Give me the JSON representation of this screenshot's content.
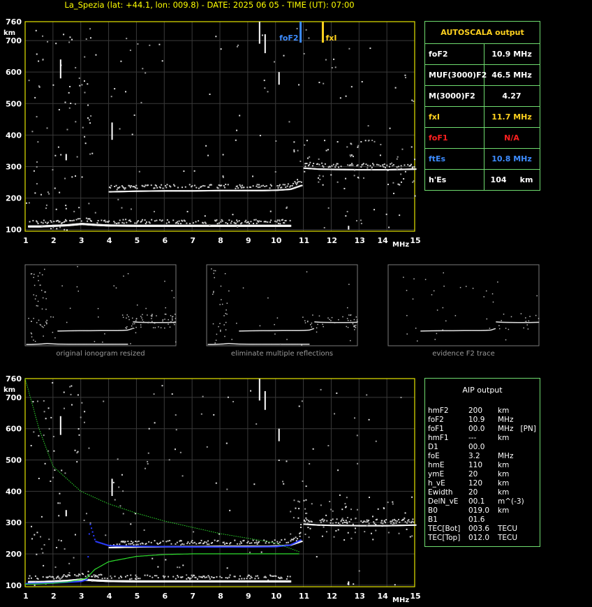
{
  "header": {
    "title": "La_Spezia (lat: +44.1, lon: 009.8) - DATE: 2025 06 05 - TIME (UT): 07:00"
  },
  "ionogram_top": {
    "y_unit": "km",
    "x_unit": "MHz",
    "y_ticks": [
      "760",
      "700",
      "600",
      "500",
      "400",
      "300",
      "200",
      "100"
    ],
    "x_ticks": [
      "1",
      "2",
      "3",
      "4",
      "5",
      "6",
      "7",
      "8",
      "9",
      "10",
      "11",
      "12",
      "13",
      "14",
      "15"
    ],
    "markers": [
      {
        "label": "foF2",
        "freq": 10.9,
        "color": "#3d8cff"
      },
      {
        "label": "fxI",
        "freq": 11.7,
        "color": "#ffd21f"
      }
    ]
  },
  "autoscala": {
    "title": "AUTOSCALA output",
    "rows": [
      {
        "name": "foF2",
        "value": "10.9 MHz",
        "color": "#ffffff"
      },
      {
        "name": "MUF(3000)F2",
        "value": "46.5 MHz",
        "color": "#ffffff"
      },
      {
        "name": "M(3000)F2",
        "value": "4.27",
        "color": "#ffffff"
      },
      {
        "name": "fxI",
        "value": "11.7 MHz",
        "color": "#ffd21f"
      },
      {
        "name": "foF1",
        "value": "N/A",
        "color": "#ff2020"
      },
      {
        "name": "ftEs",
        "value": "10.8 MHz",
        "color": "#3d8cff"
      },
      {
        "name": "h'Es",
        "value": "104     km",
        "color": "#ffffff"
      }
    ]
  },
  "panels": [
    {
      "caption": "original ionogram resized"
    },
    {
      "caption": "eliminate multiple reflections"
    },
    {
      "caption": "evidence F2 trace"
    }
  ],
  "ionogram_bottom": {
    "y_unit": "km",
    "x_unit": "MHz",
    "y_ticks": [
      "760",
      "700",
      "600",
      "500",
      "400",
      "300",
      "200",
      "100"
    ],
    "x_ticks": [
      "1",
      "2",
      "3",
      "4",
      "5",
      "6",
      "7",
      "8",
      "9",
      "10",
      "11",
      "12",
      "13",
      "14",
      "15"
    ]
  },
  "aip": {
    "title": "AIP output",
    "rows": [
      {
        "name": "hmF2",
        "value": "200",
        "unit": "km"
      },
      {
        "name": "foF2",
        "value": "10.9",
        "unit": "MHz"
      },
      {
        "name": "foF1",
        "value": "00.0",
        "unit": "MHz   [PN]"
      },
      {
        "name": "hmF1",
        "value": "---",
        "unit": "km"
      },
      {
        "name": "D1",
        "value": "00.0",
        "unit": ""
      },
      {
        "name": "foE",
        "value": "3.2",
        "unit": "MHz"
      },
      {
        "name": "hmE",
        "value": "110",
        "unit": "km"
      },
      {
        "name": "ymE",
        "value": "20",
        "unit": "km"
      },
      {
        "name": "h_vE",
        "value": "120",
        "unit": "km"
      },
      {
        "name": "Ewidth",
        "value": "20",
        "unit": "km"
      },
      {
        "name": "DelN_vE",
        "value": "00.1",
        "unit": "m^(-3)"
      },
      {
        "name": "B0",
        "value": "019.0",
        "unit": "km"
      },
      {
        "name": "B1",
        "value": "01.6",
        "unit": ""
      },
      {
        "name": "TEC[Bot]",
        "value": "003.6",
        "unit": "TECU"
      },
      {
        "name": "TEC[Top]",
        "value": "012.0",
        "unit": "TECU"
      }
    ]
  },
  "chart_data": {
    "type": "scatter",
    "xlabel": "MHz",
    "ylabel": "km",
    "xlim": [
      1,
      15
    ],
    "ylim": [
      95,
      760
    ],
    "grid": true,
    "series": [
      {
        "name": "",
        "trace": "E/Es echo",
        "x": [
          1.1,
          1.5,
          2.0,
          2.5,
          3.0,
          3.5,
          4.0,
          5.0,
          6.0,
          7.0,
          8.0,
          9.0,
          10.0,
          10.5
        ],
        "y": [
          110,
          110,
          112,
          114,
          118,
          115,
          113,
          112,
          112,
          112,
          112,
          112,
          112,
          112
        ]
      },
      {
        "name": "",
        "trace": "F2 echo",
        "x": [
          4.0,
          4.5,
          5.0,
          6.0,
          7.0,
          8.0,
          9.0,
          9.5,
          10.0,
          10.5,
          10.9
        ],
        "y": [
          220,
          221,
          222,
          223,
          223,
          224,
          224,
          224,
          225,
          228,
          240
        ]
      },
      {
        "name": "",
        "trace": "F2 x-mode",
        "x": [
          11.0,
          11.5,
          12.0,
          13.0,
          14.0,
          15.0
        ],
        "y": [
          295,
          292,
          291,
          290,
          290,
          292
        ]
      },
      {
        "name": "",
        "trace": "synthetic O trace (blue)",
        "x": [
          1.0,
          2.0,
          3.0,
          3.2,
          3.3,
          3.5,
          4.0,
          5.0,
          6.0,
          7.0,
          8.0,
          9.0,
          10.0,
          10.5,
          10.9
        ],
        "y": [
          105,
          107,
          112,
          118,
          300,
          240,
          226,
          224,
          223,
          222,
          222,
          222,
          223,
          228,
          245
        ]
      },
      {
        "name": "",
        "trace": "N(h) profile (green)",
        "x": [
          1.0,
          1.5,
          2.0,
          2.5,
          3.0,
          3.2,
          3.5,
          4.0,
          5.0,
          6.0,
          7.0,
          8.0,
          9.0,
          10.0,
          10.9
        ],
        "y": [
          103,
          104,
          106,
          110,
          118,
          122,
          150,
          175,
          192,
          198,
          200,
          200,
          200,
          200,
          200
        ]
      },
      {
        "name": "",
        "trace": "topside profile (green)",
        "x": [
          1.0,
          1.5,
          2.0,
          3.0,
          4.0,
          5.0,
          6.0,
          7.0,
          8.0,
          9.0,
          10.0,
          10.9
        ],
        "y": [
          760,
          600,
          480,
          400,
          360,
          330,
          305,
          285,
          265,
          250,
          235,
          205
        ]
      }
    ]
  }
}
